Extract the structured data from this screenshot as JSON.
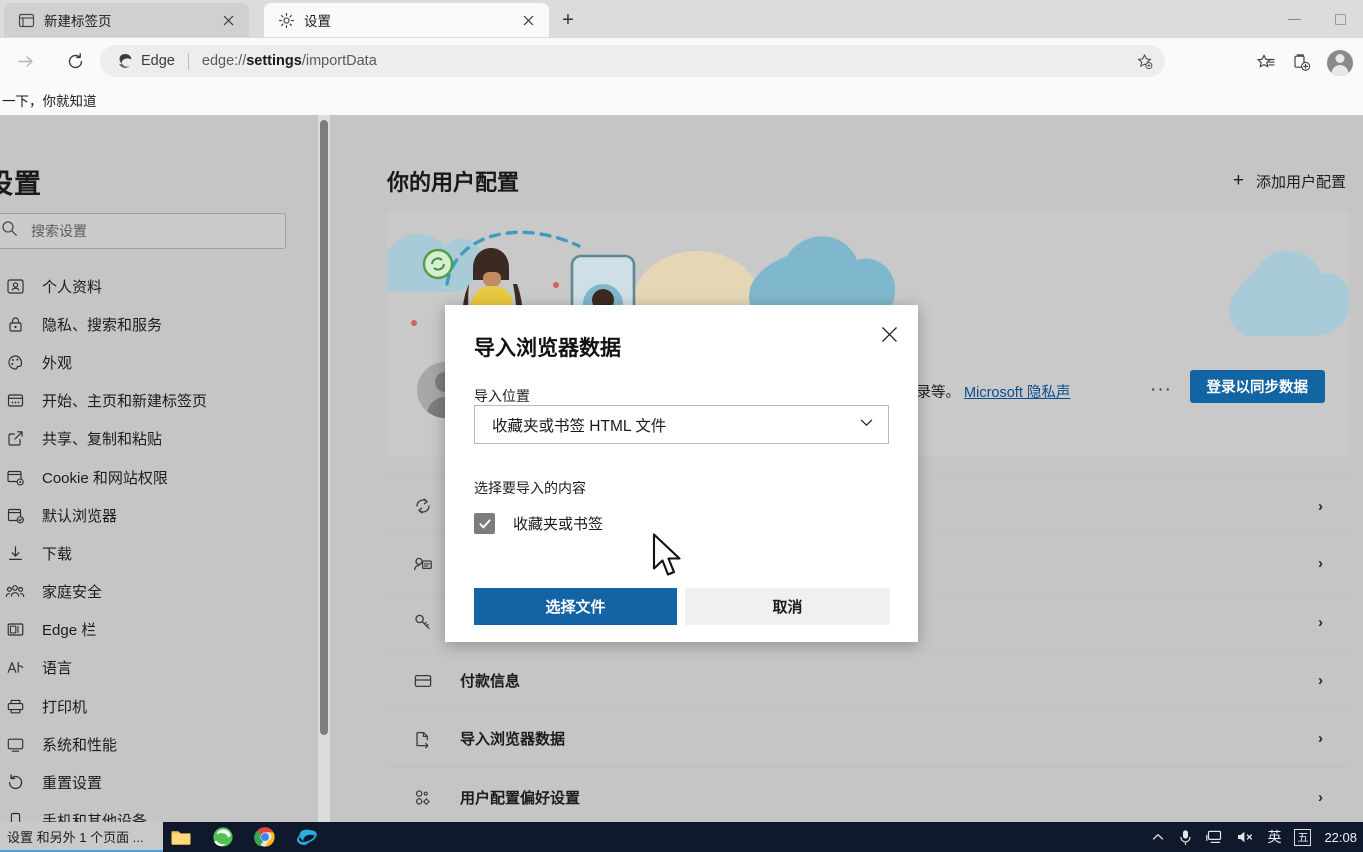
{
  "browser": {
    "tabs": [
      {
        "title": "新建标签页",
        "icon": "new-tab-page-icon",
        "active": false
      },
      {
        "title": "设置",
        "icon": "gear-icon",
        "active": true
      }
    ],
    "new_tab_button": "+",
    "window_controls": {
      "minimize": "minimize-icon",
      "maximize": "maximize-icon"
    },
    "omnibox": {
      "badge_label": "Edge",
      "url_scheme": "edge://",
      "url_bold": "settings",
      "url_rest": "/importData",
      "favorite_icon": "add-favorite-icon"
    },
    "toolbar_icons": [
      "forward-arrow-icon",
      "reload-icon",
      "favorites-icon",
      "collections-icon",
      "profile-avatar-icon"
    ],
    "bookmarks": [
      {
        "label": "一下，你就知道"
      }
    ]
  },
  "sidebar": {
    "title": "设置",
    "search_placeholder": "搜索设置",
    "items": [
      {
        "label": "个人资料",
        "icon": "profile-icon"
      },
      {
        "label": "隐私、搜索和服务",
        "icon": "lock-icon"
      },
      {
        "label": "外观",
        "icon": "palette-icon"
      },
      {
        "label": "开始、主页和新建标签页",
        "icon": "browser-window-icon"
      },
      {
        "label": "共享、复制和粘贴",
        "icon": "share-icon"
      },
      {
        "label": "Cookie 和网站权限",
        "icon": "cookie-settings-icon"
      },
      {
        "label": "默认浏览器",
        "icon": "default-browser-icon"
      },
      {
        "label": "下载",
        "icon": "download-icon"
      },
      {
        "label": "家庭安全",
        "icon": "family-icon"
      },
      {
        "label": "Edge 栏",
        "icon": "edge-bar-icon"
      },
      {
        "label": "语言",
        "icon": "language-icon"
      },
      {
        "label": "打印机",
        "icon": "printer-icon"
      },
      {
        "label": "系统和性能",
        "icon": "system-icon"
      },
      {
        "label": "重置设置",
        "icon": "reset-icon"
      },
      {
        "label": "手机和其他设备",
        "icon": "phone-icon"
      }
    ]
  },
  "main": {
    "heading": "你的用户配置",
    "add_profile_label": "添加用户配置",
    "add_profile_plus": "+",
    "profile_card": {
      "description": "记录等。",
      "link_text": "Microsoft 隐私声",
      "more_dots": "···",
      "sign_in_button": "登录以同步数据"
    },
    "rows": [
      {
        "label": "",
        "icon": "sync-icon",
        "chevron": "›"
      },
      {
        "label": "",
        "icon": "personal-info-icon",
        "chevron": "›"
      },
      {
        "label": "",
        "icon": "password-key-icon",
        "chevron": "›"
      },
      {
        "label": "付款信息",
        "icon": "payment-card-icon",
        "chevron": "›"
      },
      {
        "label": "导入浏览器数据",
        "icon": "import-data-icon",
        "chevron": "›"
      },
      {
        "label": "用户配置偏好设置",
        "icon": "profile-preferences-icon",
        "chevron": "›"
      }
    ]
  },
  "modal": {
    "title": "导入浏览器数据",
    "close_icon": "close-icon",
    "source_label": "导入位置",
    "source_value": "收藏夹或书签 HTML 文件",
    "dropdown_icon": "chevron-down-icon",
    "content_label": "选择要导入的内容",
    "checkbox": {
      "label": "收藏夹或书签",
      "checked": true,
      "check_glyph": "✓"
    },
    "primary_button": "选择文件",
    "secondary_button": "取消"
  },
  "taskbar": {
    "preview_label": "设置 和另外 1 个页面 ...",
    "apps": [
      {
        "name": "file-explorer-icon"
      },
      {
        "name": "edge-legacy-icon"
      },
      {
        "name": "chrome-icon"
      },
      {
        "name": "internet-explorer-icon"
      }
    ],
    "tray": {
      "chevron": "⌃",
      "mic": "mic-icon",
      "network": "network-icon",
      "volume": "volume-muted-icon",
      "ime_lang": "英",
      "ime_mode": "五"
    },
    "clock": "22:08"
  },
  "colors": {
    "accent_blue": "#1264a3",
    "modal_button_blue": "#1464a5",
    "link_blue": "#0b4d8f",
    "page_bg": "#c5c5c5",
    "taskbar_bg": "#10182b"
  }
}
